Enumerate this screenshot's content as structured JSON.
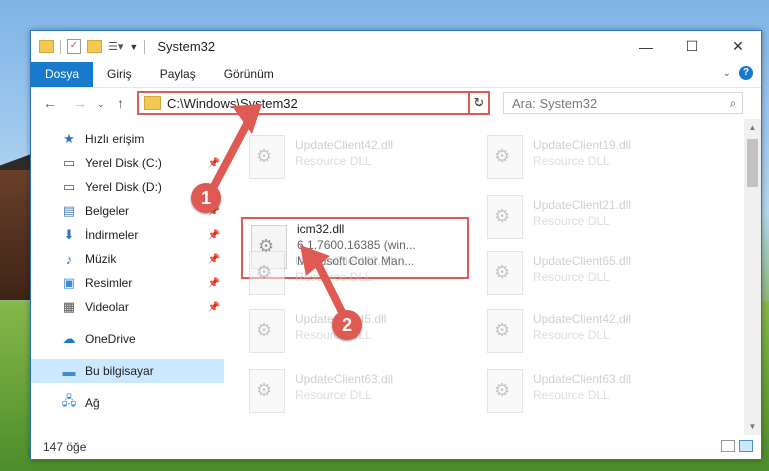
{
  "window": {
    "title": "System32",
    "min_label": "—",
    "max_label": "☐",
    "close_label": "✕"
  },
  "ribbon": {
    "tabs": [
      "Dosya",
      "Giriş",
      "Paylaş",
      "Görünüm"
    ]
  },
  "address_bar": {
    "path": "C:\\Windows\\System32",
    "refresh_label": "↻"
  },
  "search": {
    "placeholder": "Ara: System32"
  },
  "sidebar": {
    "items": [
      {
        "label": "Hızlı erişim",
        "icon": "star-icon"
      },
      {
        "label": "Yerel Disk (C:)",
        "icon": "drive-icon"
      },
      {
        "label": "Yerel Disk (D:)",
        "icon": "drive-icon"
      },
      {
        "label": "Belgeler",
        "icon": "documents-icon"
      },
      {
        "label": "İndirmeler",
        "icon": "download-icon"
      },
      {
        "label": "Müzik",
        "icon": "music-icon"
      },
      {
        "label": "Resimler",
        "icon": "pictures-icon"
      },
      {
        "label": "Videolar",
        "icon": "videos-icon"
      },
      {
        "label": "OneDrive",
        "icon": "cloud-icon"
      },
      {
        "label": "Bu bilgisayar",
        "icon": "computer-icon"
      },
      {
        "label": "Ağ",
        "icon": "network-icon"
      }
    ]
  },
  "files": [
    {
      "name": "UpdateClient42.dll",
      "desc": "Resource DLL"
    },
    {
      "name": "UpdateClient19.dll",
      "desc": "Resource DLL"
    },
    {
      "name": "icm32.dll",
      "line2": "6.1.7600.16385 (win...",
      "desc": "Microsoft Color Man..."
    },
    {
      "name": "UpdateClient21.dll",
      "desc": "Resource DLL"
    },
    {
      "name": "UpdateClient42.dll",
      "desc": "Resource DLL"
    },
    {
      "name": "UpdateClient65.dll",
      "desc": "Resource DLL"
    },
    {
      "name": "UpdateClient5.dll",
      "desc": "Resource DLL"
    },
    {
      "name": "UpdateClient42.dll",
      "desc": "Resource DLL"
    },
    {
      "name": "UpdateClient63.dll",
      "desc": "Resource DLL"
    },
    {
      "name": "UpdateClient63.dll",
      "desc": "Resource DLL"
    }
  ],
  "status": {
    "item_count": "147 öğe"
  },
  "markers": {
    "one": "1",
    "two": "2"
  }
}
